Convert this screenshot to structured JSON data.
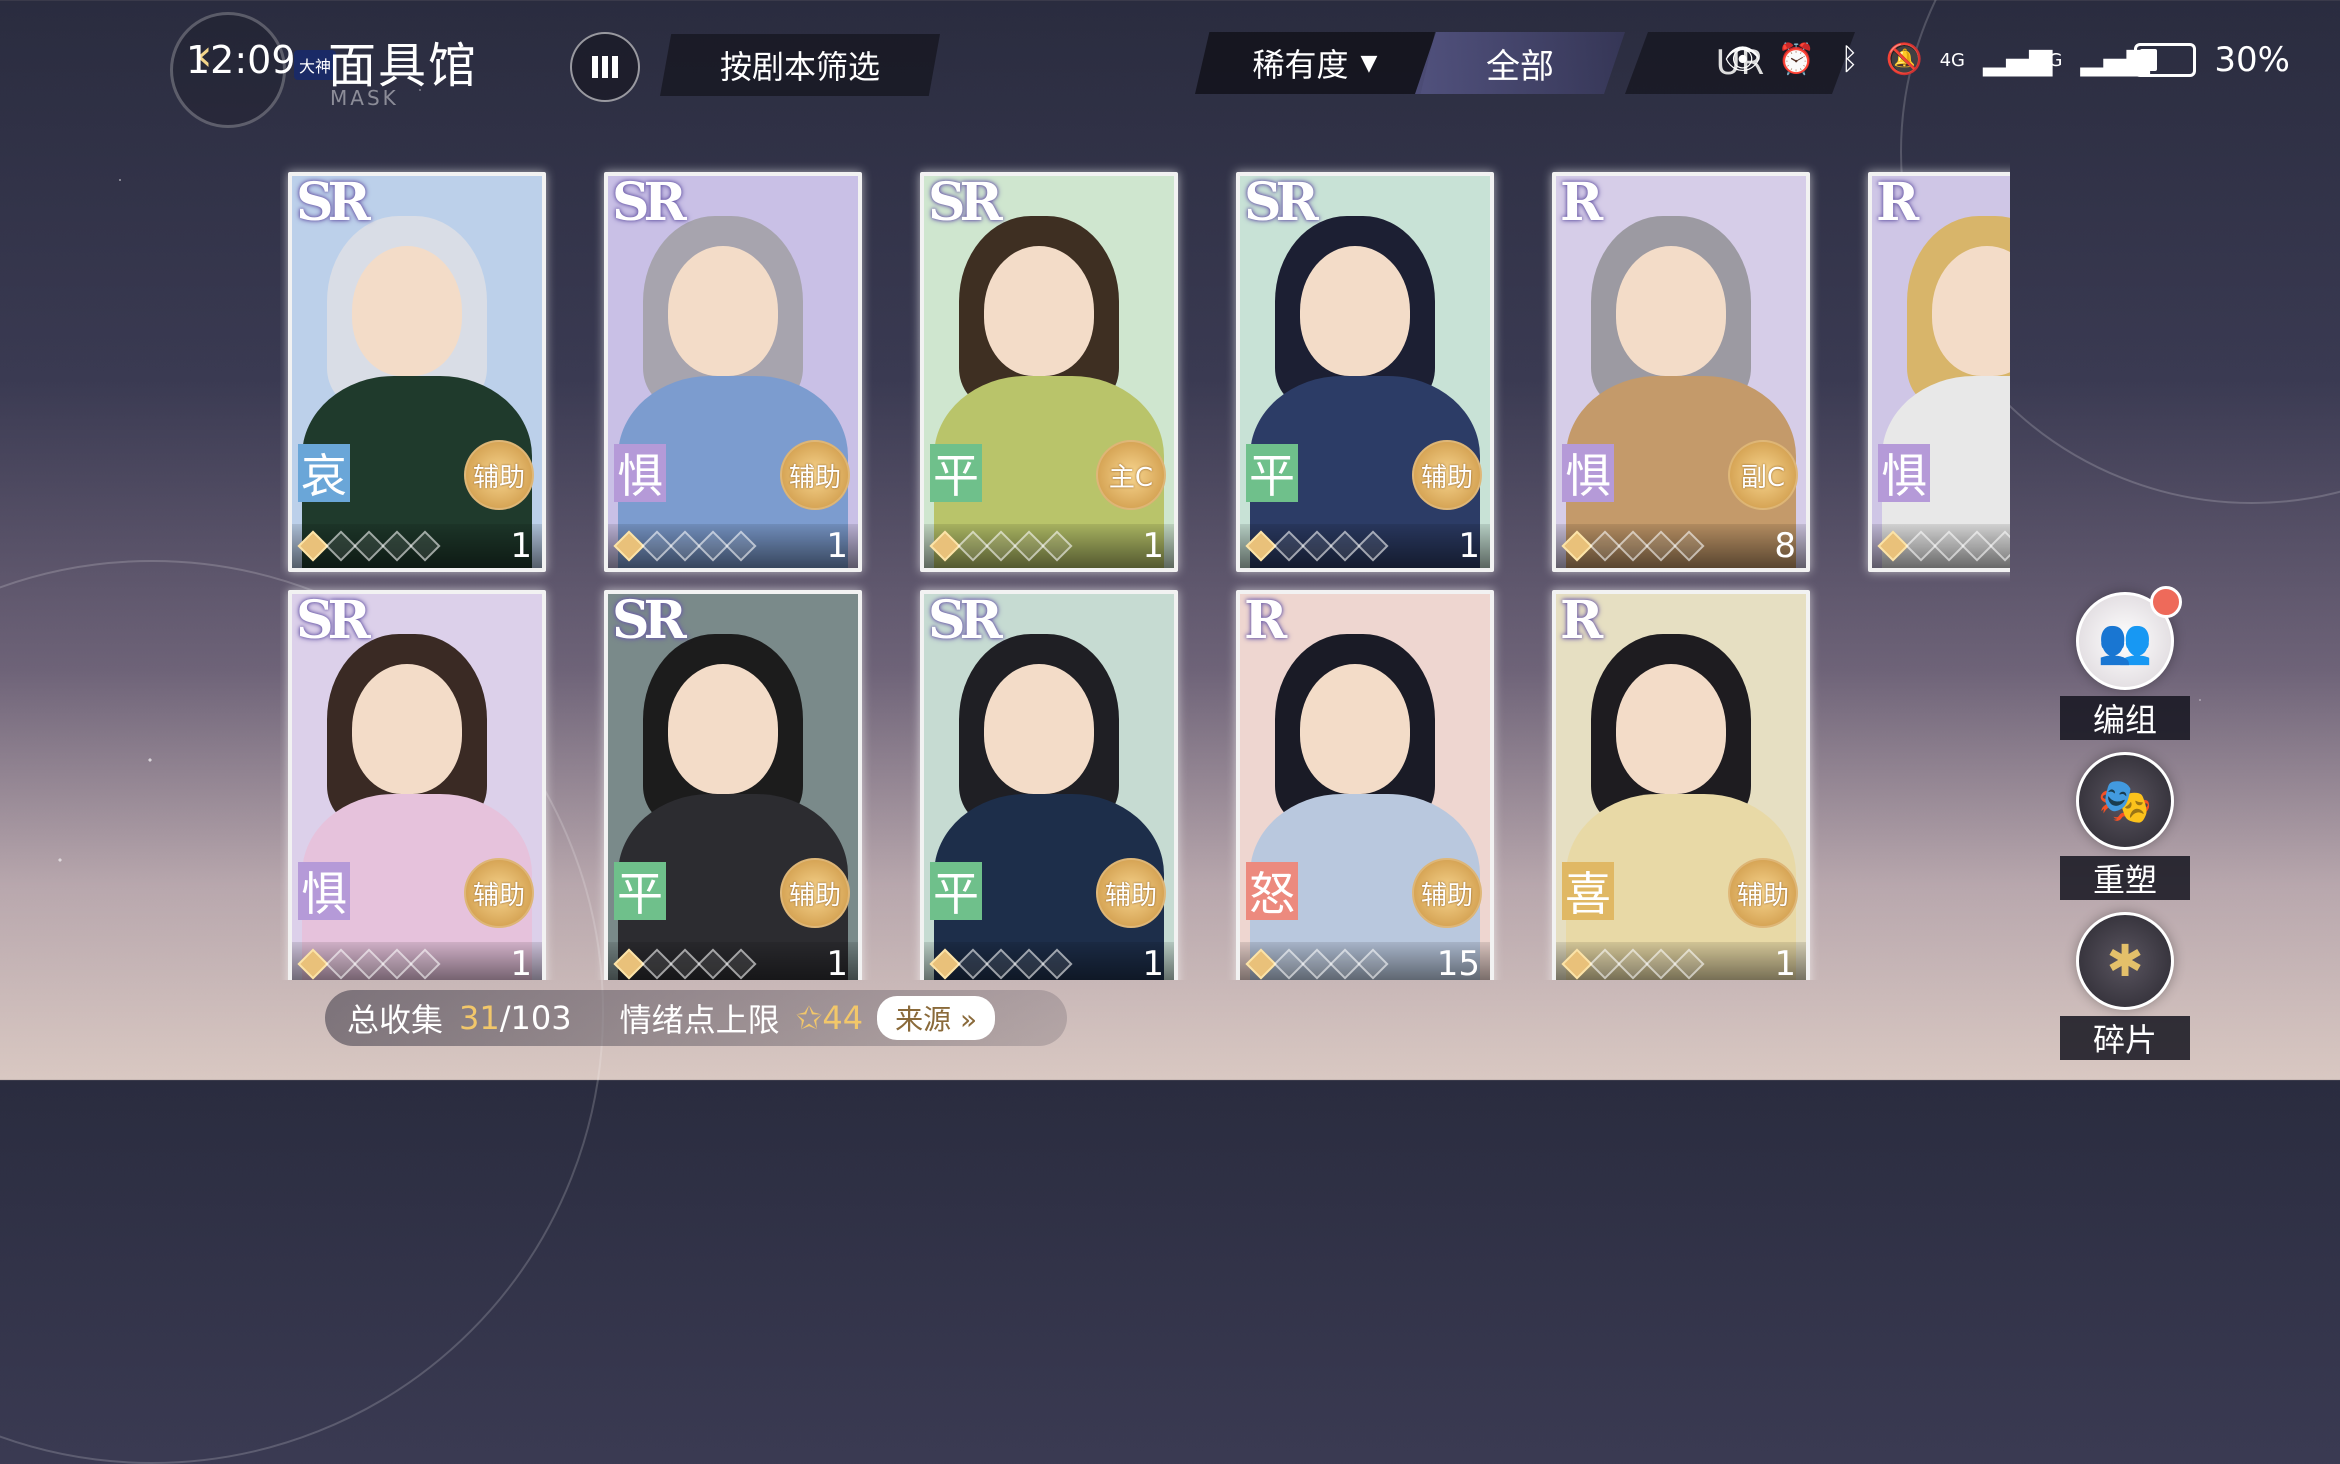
{
  "status": {
    "time": "12:09",
    "battery_text": "30%",
    "battery_level": 0.3,
    "net_1": "4G",
    "net_2": "4G"
  },
  "header": {
    "brand_badge": "大神",
    "title": "面具馆",
    "subtitle": "MASK",
    "filter_label": "按剧本筛选",
    "rarity_select": "稀有度",
    "rarity_arrow": "▼",
    "tab_all": "全部",
    "tab_ur": "UR"
  },
  "cards": [
    {
      "rarity": "SR",
      "emotion": "哀",
      "role": "辅助",
      "count": "1",
      "bg": "#bcd0ea",
      "emotion_bg": "#6aa6d8"
    },
    {
      "rarity": "SR",
      "emotion": "惧",
      "role": "辅助",
      "count": "1",
      "bg": "#c9c0e6",
      "emotion_bg": "#b59ad8"
    },
    {
      "rarity": "SR",
      "emotion": "平",
      "role": "主C",
      "count": "1",
      "bg": "#cfe6cf",
      "emotion_bg": "#6fc08b"
    },
    {
      "rarity": "SR",
      "emotion": "平",
      "role": "辅助",
      "count": "1",
      "bg": "#c8e2d6",
      "emotion_bg": "#6fc08b"
    },
    {
      "rarity": "R",
      "emotion": "惧",
      "role": "副C",
      "count": "8",
      "bg": "#d6cde8",
      "emotion_bg": "#b59ad8"
    },
    {
      "rarity": "R",
      "emotion": "惧",
      "role": "",
      "count": "",
      "bg": "#cfc6e6",
      "emotion_bg": "#b59ad8"
    },
    {
      "rarity": "SR",
      "emotion": "惧",
      "role": "辅助",
      "count": "1",
      "bg": "#dcd0ea",
      "emotion_bg": "#b59ad8"
    },
    {
      "rarity": "SR",
      "emotion": "平",
      "role": "辅助",
      "count": "1",
      "bg": "#7a8a8a",
      "emotion_bg": "#6fc08b"
    },
    {
      "rarity": "SR",
      "emotion": "平",
      "role": "辅助",
      "count": "1",
      "bg": "#c6dbd2",
      "emotion_bg": "#6fc08b"
    },
    {
      "rarity": "R",
      "emotion": "怒",
      "role": "辅助",
      "count": "15",
      "bg": "#eed6d0",
      "emotion_bg": "#ec8a7e"
    },
    {
      "rarity": "R",
      "emotion": "喜",
      "role": "辅助",
      "count": "1",
      "bg": "#e6dfc2",
      "emotion_bg": "#e0b864"
    }
  ],
  "side": {
    "team_label": "编组",
    "reshape_label": "重塑",
    "fragment_label": "碎片"
  },
  "bottom": {
    "collect_label": "总收集",
    "collect_count": "31",
    "collect_total": "/103",
    "emotion_label": "情绪点上限",
    "emotion_value": "44",
    "source_label": "来源 »"
  }
}
